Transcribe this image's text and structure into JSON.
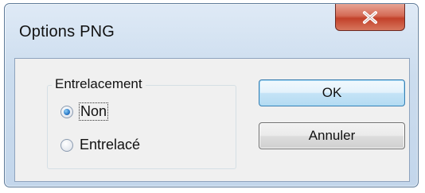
{
  "window": {
    "title": "Options PNG",
    "close_glyph": "X"
  },
  "group": {
    "label": "Entrelacement",
    "options": [
      {
        "label": "Non",
        "checked": true
      },
      {
        "label": "Entrelacé",
        "checked": false
      }
    ]
  },
  "buttons": {
    "ok_label": "OK",
    "cancel_label": "Annuler"
  },
  "icons": {
    "close": "close-icon"
  },
  "colors": {
    "title_bar": "#cbdcee",
    "close_button": "#c2412a",
    "default_button_border": "#3c7fb1",
    "radio_selected": "#2b79c7"
  }
}
